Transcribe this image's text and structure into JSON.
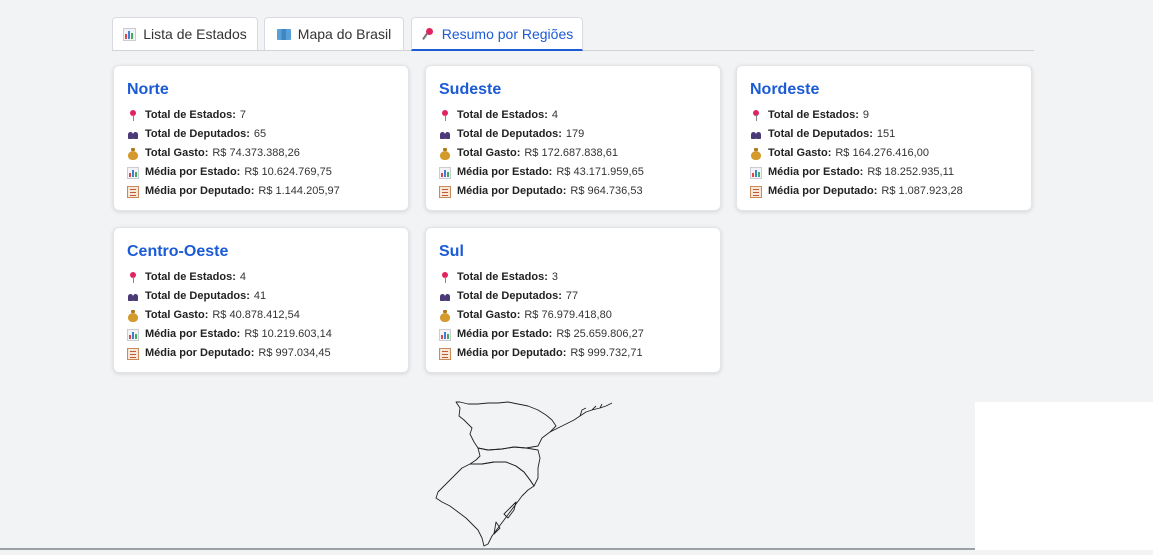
{
  "tabs": [
    {
      "label": "Lista de Estados",
      "icon": "bar-chart-icon",
      "active": false
    },
    {
      "label": "Mapa do Brasil",
      "icon": "map-icon",
      "active": false
    },
    {
      "label": "Resumo por Regiões",
      "icon": "pushpin-icon",
      "active": true
    }
  ],
  "labels": {
    "total_estados": "Total de Estados:",
    "total_deputados": "Total de Deputados:",
    "total_gasto": "Total Gasto:",
    "media_estado": "Média por Estado:",
    "media_deputado": "Média por Deputado:"
  },
  "regions": [
    {
      "name": "Norte",
      "total_estados": "7",
      "total_deputados": "65",
      "total_gasto": "R$ 74.373.388,26",
      "media_estado": "R$ 10.624.769,75",
      "media_deputado": "R$ 1.144.205,97"
    },
    {
      "name": "Sudeste",
      "total_estados": "4",
      "total_deputados": "179",
      "total_gasto": "R$ 172.687.838,61",
      "media_estado": "R$ 43.171.959,65",
      "media_deputado": "R$ 964.736,53"
    },
    {
      "name": "Nordeste",
      "total_estados": "9",
      "total_deputados": "151",
      "total_gasto": "R$ 164.276.416,00",
      "media_estado": "R$ 18.252.935,11",
      "media_deputado": "R$ 1.087.923,28"
    },
    {
      "name": "Centro-Oeste",
      "total_estados": "4",
      "total_deputados": "41",
      "total_gasto": "R$ 40.878.412,54",
      "media_estado": "R$ 10.219.603,14",
      "media_deputado": "R$ 997.034,45"
    },
    {
      "name": "Sul",
      "total_estados": "3",
      "total_deputados": "77",
      "total_gasto": "R$ 76.979.418,80",
      "media_estado": "R$ 25.659.806,27",
      "media_deputado": "R$ 999.732,71"
    }
  ],
  "colors": {
    "accent": "#1c5bd6",
    "background": "#f2f3f4",
    "card": "#ffffff"
  }
}
